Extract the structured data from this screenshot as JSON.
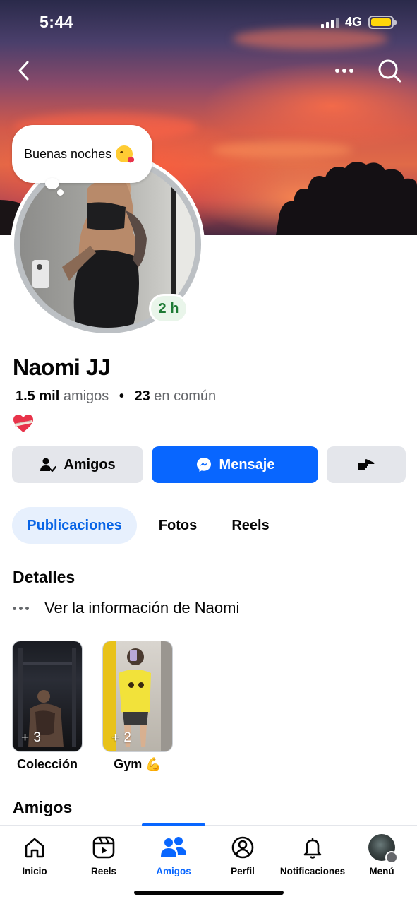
{
  "status_bar": {
    "time": "5:44",
    "network": "4G"
  },
  "icons": {
    "back": "chevron-left-icon",
    "more": "more-horizontal-icon",
    "search": "search-icon",
    "friends_button": "person-check-icon",
    "message_button": "messenger-icon",
    "more_button": "hand-pointing-icon"
  },
  "note": {
    "text": "Buenas noches"
  },
  "profile": {
    "name": "Naomi JJ",
    "active_time": "2 h",
    "friend_count": "1.5 mil",
    "friend_label": "amigos",
    "mutual_count": "23",
    "mutual_label": "en común"
  },
  "actions": {
    "friends_label": "Amigos",
    "message_label": "Mensaje"
  },
  "tabs": [
    {
      "label": "Publicaciones",
      "active": true
    },
    {
      "label": "Fotos",
      "active": false
    },
    {
      "label": "Reels",
      "active": false
    }
  ],
  "details": {
    "title": "Detalles",
    "see_info": "Ver la información de Naomi"
  },
  "highlights": [
    {
      "label": "Colección",
      "count": "+ 3"
    },
    {
      "label": "Gym 💪",
      "count": "+ 2"
    }
  ],
  "friends_section": {
    "title": "Amigos"
  },
  "bottom_nav": [
    {
      "label": "Inicio",
      "icon": "home-icon",
      "active": false
    },
    {
      "label": "Reels",
      "icon": "reels-icon",
      "active": false
    },
    {
      "label": "Amigos",
      "icon": "friends-icon",
      "active": true
    },
    {
      "label": "Perfil",
      "icon": "profile-icon",
      "active": false
    },
    {
      "label": "Notificaciones",
      "icon": "bell-icon",
      "active": false
    },
    {
      "label": "Menú",
      "icon": "menu-avatar-icon",
      "active": false
    }
  ],
  "colors": {
    "primary_blue": "#0866ff",
    "active_badge_green": "#1e7a35",
    "button_gray": "#e4e6eb",
    "tab_active_bg": "#e7f0fd",
    "battery_yellow": "#ffd60a"
  }
}
